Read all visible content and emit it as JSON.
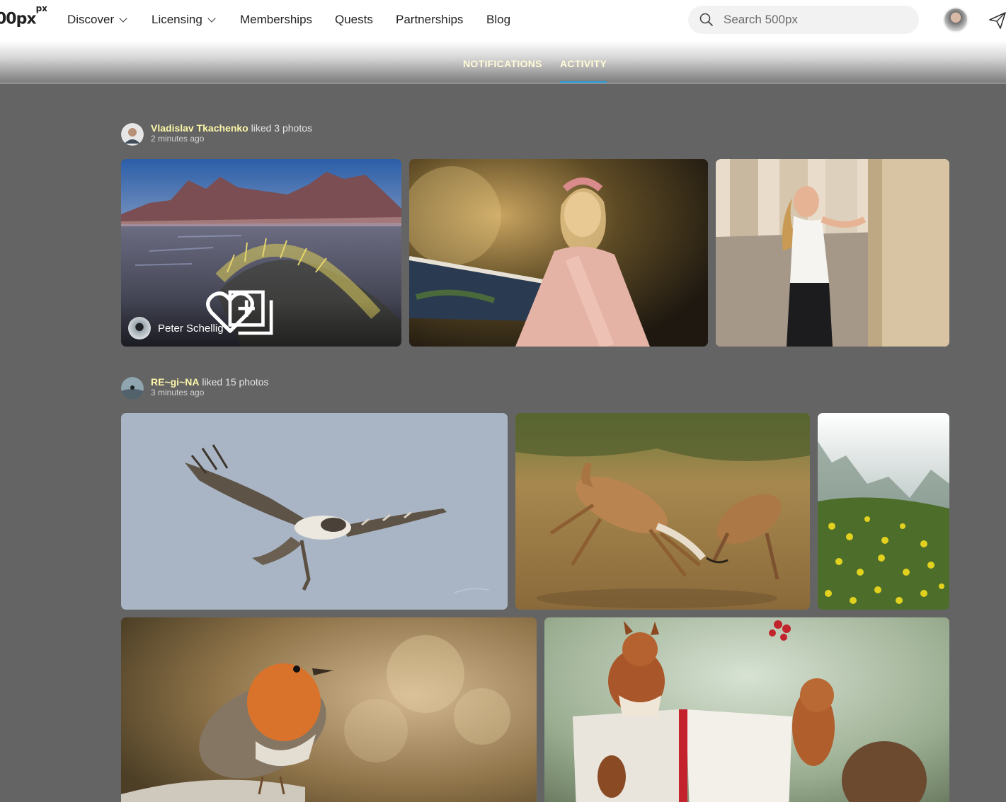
{
  "header": {
    "logo": "00px",
    "logo_sup": "px",
    "nav": [
      {
        "label": "Discover",
        "dropdown": true
      },
      {
        "label": "Licensing",
        "dropdown": true
      },
      {
        "label": "Memberships",
        "dropdown": false
      },
      {
        "label": "Quests",
        "dropdown": false
      },
      {
        "label": "Partnerships",
        "dropdown": false
      },
      {
        "label": "Blog",
        "dropdown": false
      }
    ],
    "search_placeholder": "Search 500px",
    "icons": {
      "search": "search-icon",
      "send": "paper-plane-icon",
      "avatar": "user-avatar"
    }
  },
  "tabs": [
    {
      "label": "NOTIFICATIONS",
      "active": false
    },
    {
      "label": "ACTIVITY",
      "active": true
    }
  ],
  "feed": [
    {
      "user": "Vladislav Tkachenko",
      "action": " liked 3 photos",
      "time": "2 minutes ago",
      "photos": [
        {
          "subject": "mountains and beach dunes",
          "author": "Peter Schellig"
        },
        {
          "subject": "woman in pink dress by boat"
        },
        {
          "subject": "woman leaning on column"
        }
      ]
    },
    {
      "user": "RE~gi~NA",
      "action": " liked 15 photos",
      "time": "3 minutes ago",
      "photos": [
        {
          "subject": "osprey in flight"
        },
        {
          "subject": "fighting gazelles"
        },
        {
          "subject": "misty forest with yellow flowers"
        },
        {
          "subject": "robin on branch"
        },
        {
          "subject": "squirrels with book"
        }
      ]
    }
  ],
  "colors": {
    "accent": "#1e9bdc",
    "username": "#fbf6a8",
    "tab_text": "#fffbd6",
    "page_bg": "#646464"
  }
}
